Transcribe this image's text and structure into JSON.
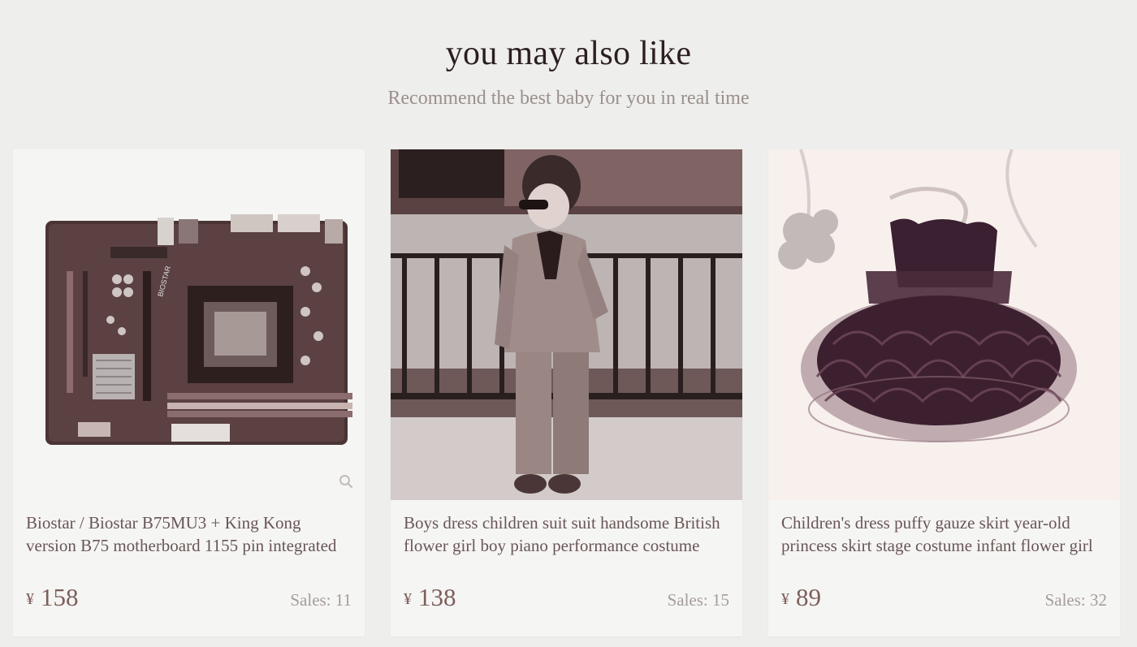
{
  "section": {
    "title": "you may also like",
    "subtitle": "Recommend the best baby for you in real time"
  },
  "colors": {
    "background": "#eeeeec",
    "card": "#f5f5f4",
    "price": "#7d5e5a",
    "title": "#2b1f1f"
  },
  "products": [
    {
      "image_icon": "motherboard-image",
      "title": "Biostar / Biostar B75MU3 + King Kong version B75 motherboard 1155 pin integrated",
      "currency": "¥",
      "price": "158",
      "sales": "Sales: 11"
    },
    {
      "image_icon": "boy-suit-photo",
      "title": "Boys dress children suit suit handsome British flower girl boy piano performance costume",
      "currency": "¥",
      "price": "138",
      "sales": "Sales: 15"
    },
    {
      "image_icon": "tutu-dress-photo",
      "title": "Children's dress puffy gauze skirt year-old princess skirt stage costume infant flower girl",
      "currency": "¥",
      "price": "89",
      "sales": "Sales: 32"
    }
  ]
}
